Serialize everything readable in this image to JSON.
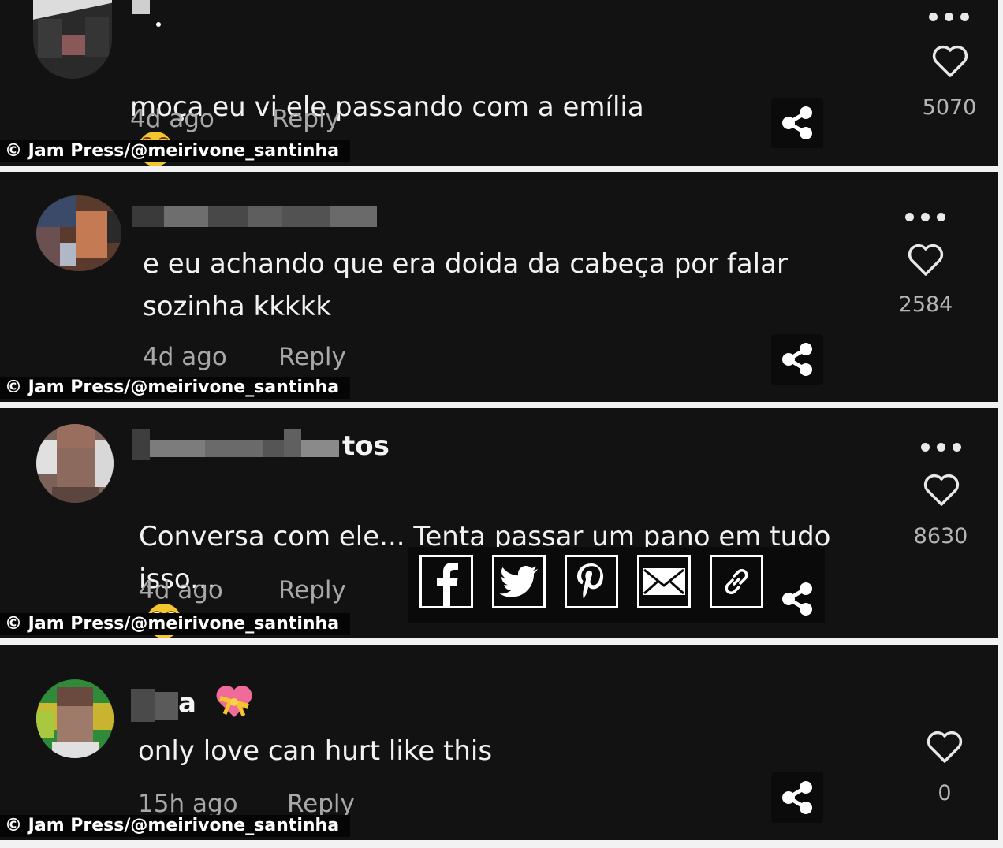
{
  "comments": [
    {
      "username": "",
      "text": "moça eu vi ele passando com a emília",
      "emoji": "pleading-face",
      "time": "4d ago",
      "reply": "Reply",
      "likes": "5070",
      "credit": "© Jam Press/@meirivone_santinha"
    },
    {
      "username": "",
      "text": "e eu achando que era doida da cabeça por falar\nsozinha kkkkk",
      "time": "4d ago",
      "reply": "Reply",
      "likes": "2584",
      "credit": "© Jam Press/@meirivone_santinha"
    },
    {
      "username": "tos",
      "text": "Conversa com ele... Tenta passar um pano em tudo\nisso...",
      "emoji": "flushed-face",
      "time": "4d ago",
      "reply": "Reply",
      "likes": "8630",
      "credit": "© Jam Press/@meirivone_santinha"
    },
    {
      "username": "a",
      "username_emoji": "heart-with-ribbon",
      "text": "only love can hurt like this",
      "time": "15h ago",
      "reply": "Reply",
      "likes": "0",
      "credit": "© Jam Press/@meirivone_santinha"
    }
  ],
  "share_options": [
    "facebook-icon",
    "twitter-icon",
    "pinterest-icon",
    "email-icon",
    "link-icon"
  ],
  "colors": {
    "panel_bg": "#121212",
    "text": "#f2f2f2",
    "muted": "#a8a8a8",
    "divider": "#f2f2f2"
  }
}
